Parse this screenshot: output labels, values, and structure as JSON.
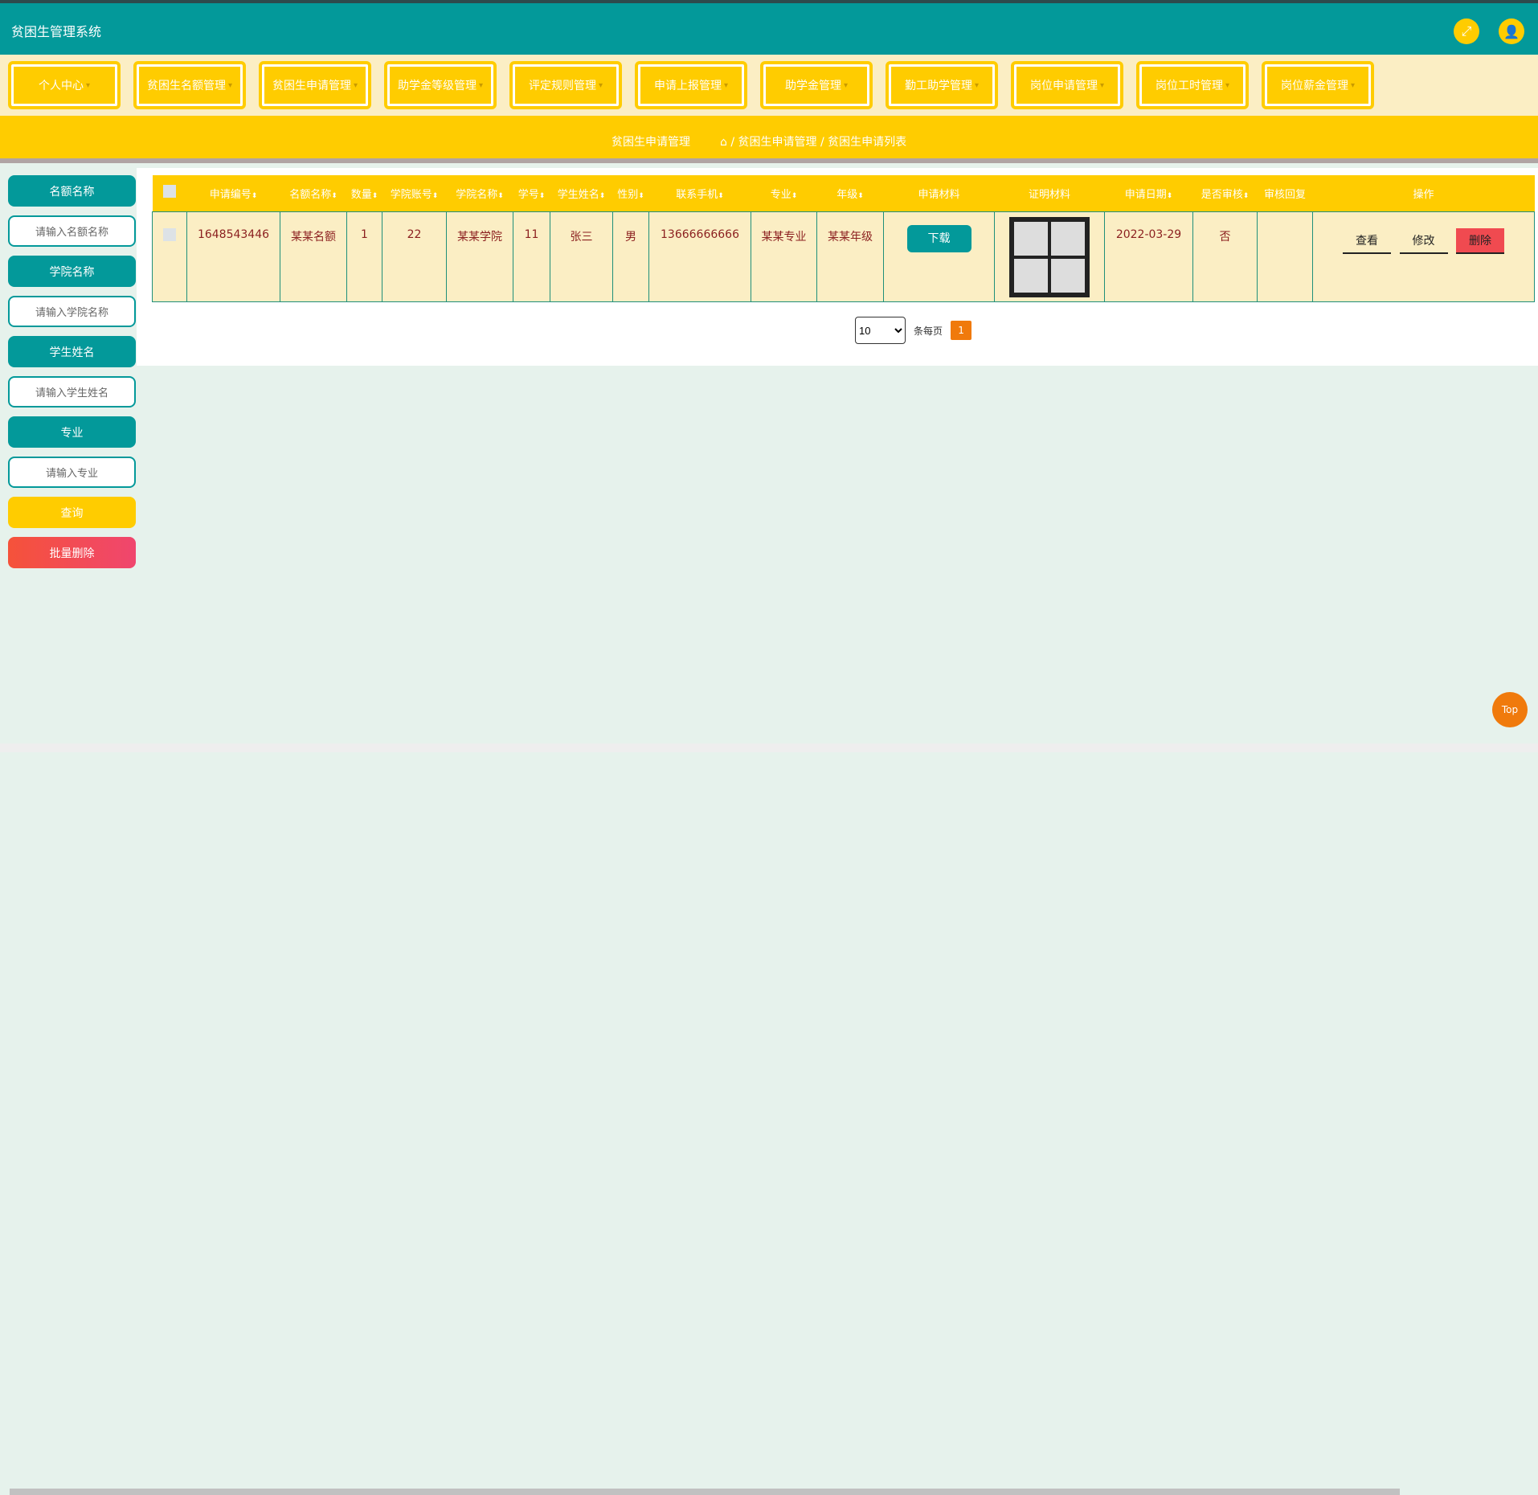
{
  "app": {
    "title": "贫困生管理系统",
    "icons": [
      "fullscreen-icon",
      "user-icon"
    ]
  },
  "nav": [
    "个人中心",
    "贫困生名额管理",
    "贫困生申请管理",
    "助学金等级管理",
    "评定规则管理",
    "申请上报管理",
    "助学金管理",
    "勤工助学管理",
    "岗位申请管理",
    "岗位工时管理",
    "岗位薪金管理"
  ],
  "breadcrumb": {
    "title": "贫困生申请管理",
    "path": "/ 贫困生申请管理 / 贫困生申请列表"
  },
  "sidebar": {
    "f1_label": "名额名称",
    "f1_ph": "请输入名额名称",
    "f2_label": "学院名称",
    "f2_ph": "请输入学院名称",
    "f3_label": "学生姓名",
    "f3_ph": "请输入学生姓名",
    "f4_label": "专业",
    "f4_ph": "请输入专业",
    "search": "查询",
    "batch_delete": "批量删除"
  },
  "table": {
    "headers": [
      "申请编号",
      "名额名称",
      "数量",
      "学院账号",
      "学院名称",
      "学号",
      "学生姓名",
      "性别",
      "联系手机",
      "专业",
      "年级",
      "申请材料",
      "证明材料",
      "申请日期",
      "是否审核",
      "审核回复",
      "操作"
    ],
    "rows": [
      {
        "id": "1648543446",
        "quota": "某某名额",
        "count": "1",
        "college_acc": "22",
        "college": "某某学院",
        "sno": "11",
        "name": "张三",
        "gender": "男",
        "phone": "13666666666",
        "major": "某某专业",
        "grade": "某某年级",
        "download": "下载",
        "date": "2022-03-29",
        "reviewed": "否",
        "reply": "",
        "view": "查看",
        "edit": "修改",
        "delete": "删除"
      }
    ]
  },
  "pager": {
    "page_size": "10",
    "per_page": "条每页",
    "page": "1"
  },
  "top": "Top",
  "colors": {
    "teal": "#03999a",
    "yellow": "#ffcc00",
    "orange": "#f07a0c"
  }
}
